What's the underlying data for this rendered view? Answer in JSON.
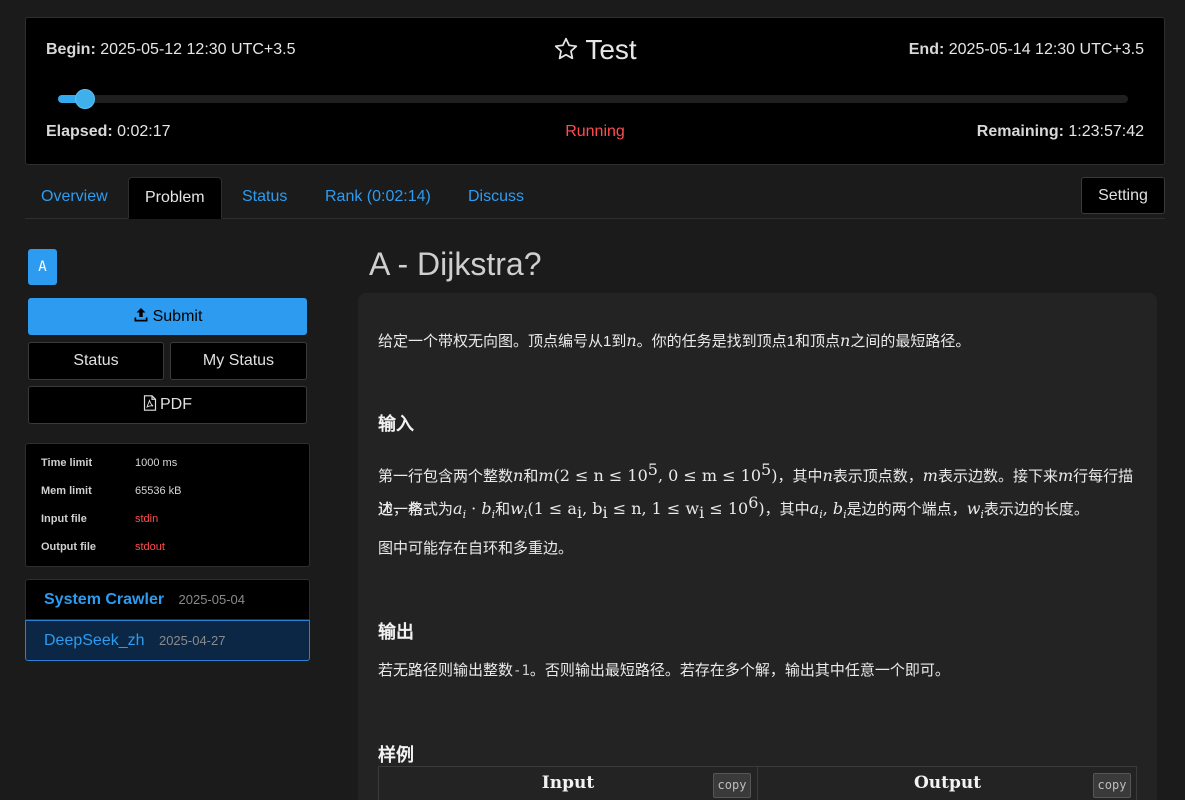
{
  "contest": {
    "begin_label": "Begin:",
    "begin_value": "2025-05-12 12:30 UTC+3.5",
    "title": "Test",
    "end_label": "End:",
    "end_value": "2025-05-14 12:30 UTC+3.5",
    "progress_fraction": 0.02,
    "elapsed_label": "Elapsed:",
    "elapsed_value": "0:02:17",
    "status": "Running",
    "remaining_label": "Remaining:",
    "remaining_value": "1:23:57:42",
    "status_color": "#ff4d4f",
    "accent_color": "#2d9cf0"
  },
  "tabs": {
    "overview": "Overview",
    "problem": "Problem",
    "status": "Status",
    "rank": "Rank (0:02:14)",
    "discuss": "Discuss",
    "setting": "Setting",
    "active": "Problem"
  },
  "sidebar": {
    "problem_letter": "A",
    "submit": "Submit",
    "status": "Status",
    "my_status": "My Status",
    "pdf": "PDF",
    "limits": [
      {
        "key": "Time limit",
        "value": "1000 ms"
      },
      {
        "key": "Mem limit",
        "value": "65536 kB"
      },
      {
        "key": "Input file",
        "value": "stdin"
      },
      {
        "key": "Output file",
        "value": "stdout"
      }
    ],
    "authors": [
      {
        "name": "System Crawler",
        "date": "2025-05-04"
      },
      {
        "name": "DeepSeek_zh",
        "date": "2025-04-27"
      }
    ]
  },
  "problem": {
    "title": "A - Dijkstra?",
    "intro_a": "给定一个带权无向图。顶点编号从1到",
    "intro_b": "。你的任务是找到顶点1和顶点",
    "intro_c": "之间的最短路径。",
    "var_n": "n",
    "var_m": "m",
    "input_heading": "输入",
    "input_p1_a": "第一行包含两个整数",
    "input_p1_and": "和",
    "input_p1_formula": "(2 ≤ n ≤ 10",
    "input_p1_formula2": ", 0 ≤ m ≤ 10",
    "exp5": "5",
    "input_p1_b": "，其中",
    "input_p1_c": "表示顶点数，",
    "input_p1_d": "表示边数。接下来",
    "input_p1_e": "行每行描述一条",
    "input_p2_a": "边，格式为",
    "input_p2_and": "和",
    "input_p2_formula": "(1 ≤ a",
    "input_p2_formula_b": ", b",
    "input_p2_formula_c": " ≤ n, 1 ≤ w",
    "input_p2_formula_d": " ≤ 10",
    "exp6": "6",
    "input_p2_b": "，其中",
    "input_p2_c": "是边的两个端点，",
    "input_p2_d": "表示边的长度。",
    "input_p3": "图中可能存在自环和多重边。",
    "output_heading": "输出",
    "output_a": "若无路径则输出整数",
    "output_code": "-1",
    "output_b": "。否则输出最短路径。若存在多个解，输出其中任意一个即可。",
    "sample_heading": "样例",
    "sample_input": "Input",
    "sample_output": "Output",
    "copy": "copy"
  }
}
